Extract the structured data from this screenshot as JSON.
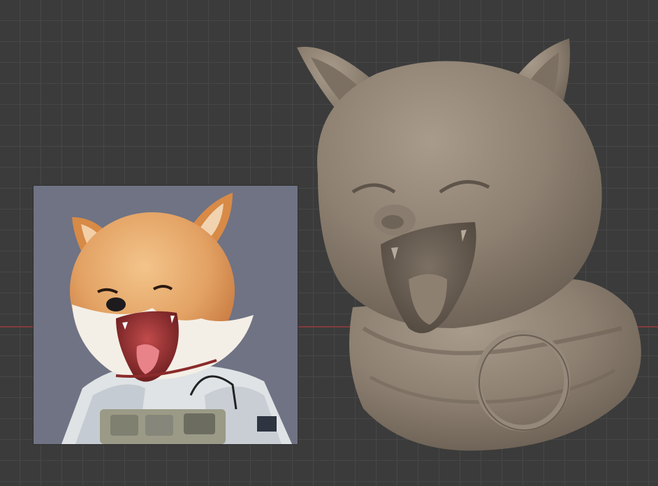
{
  "viewport": {
    "background": "#3b3b3b",
    "grid_color": "#474747",
    "x_axis_color": "#8e3c3e"
  },
  "reference_image": {
    "subject": "shiba-inu-yawning-illustration",
    "background": "#6f7384"
  },
  "sculpt": {
    "subject": "clay-dog-bust-with-collar-ring",
    "clay_color": "#8f8273"
  }
}
